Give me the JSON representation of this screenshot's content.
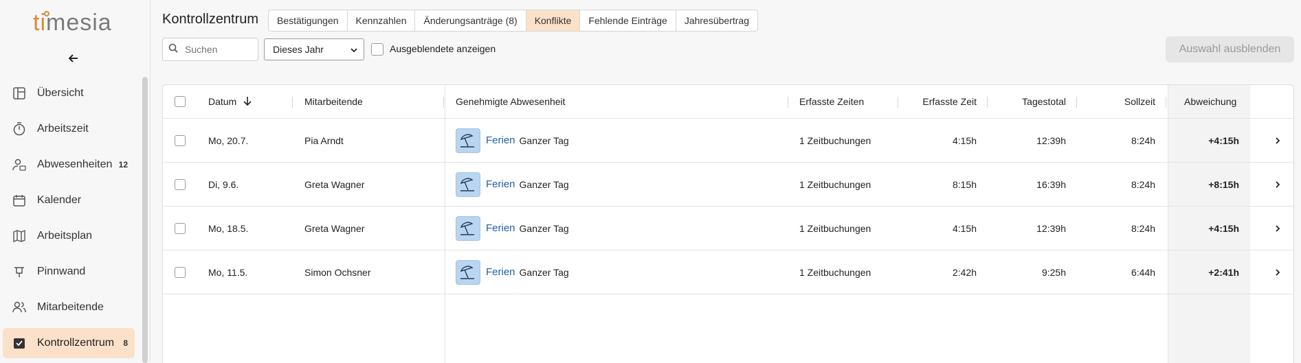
{
  "app": {
    "logo_ti": "ti",
    "logo_rest": "mesia"
  },
  "sidebar": {
    "collapse_icon": "arrow-left-icon",
    "items": [
      {
        "label": "Übersicht",
        "icon": "layout-icon",
        "badge": ""
      },
      {
        "label": "Arbeitszeit",
        "icon": "stopwatch-icon",
        "badge": ""
      },
      {
        "label": "Abwesenheiten",
        "icon": "person-absence-icon",
        "badge": "12"
      },
      {
        "label": "Kalender",
        "icon": "calendar-icon",
        "badge": ""
      },
      {
        "label": "Arbeitsplan",
        "icon": "map-icon",
        "badge": ""
      },
      {
        "label": "Pinnwand",
        "icon": "pin-board-icon",
        "badge": ""
      },
      {
        "label": "Mitarbeitende",
        "icon": "people-icon",
        "badge": ""
      },
      {
        "label": "Kontrollzentrum",
        "icon": "checkbox-icon",
        "badge": "8",
        "active": true
      }
    ]
  },
  "header": {
    "title": "Kontrollzentrum",
    "tabs": [
      "Bestätigungen",
      "Kennzahlen",
      "Änderungsanträge (8)",
      "Konflikte",
      "Fehlende Einträge",
      "Jahresübertrag"
    ],
    "active_tab": "Konflikte"
  },
  "filters": {
    "search_placeholder": "Suchen",
    "period": "Dieses Jahr",
    "show_hidden_label": "Ausgeblendete anzeigen",
    "hide_selection_label": "Auswahl ausblenden"
  },
  "table": {
    "columns": {
      "date": "Datum",
      "employee": "Mitarbeitende",
      "absence": "Genehmigte Abwesenheit",
      "entries": "Erfasste Zeiten",
      "recorded": "Erfasste Zeit",
      "daily_total": "Tagestotal",
      "target": "Sollzeit",
      "deviation": "Abweichung"
    },
    "rows": [
      {
        "date": "Mo, 20.7.",
        "employee": "Pia Arndt",
        "absence_type": "Ferien",
        "absence_duration": "Ganzer Tag",
        "entries": "1 Zeitbuchungen",
        "recorded": "4:15h",
        "daily_total": "12:39h",
        "target": "8:24h",
        "deviation": "+4:15h"
      },
      {
        "date": "Di, 9.6.",
        "employee": "Greta Wagner",
        "absence_type": "Ferien",
        "absence_duration": "Ganzer Tag",
        "entries": "1 Zeitbuchungen",
        "recorded": "8:15h",
        "daily_total": "16:39h",
        "target": "8:24h",
        "deviation": "+8:15h"
      },
      {
        "date": "Mo, 18.5.",
        "employee": "Greta Wagner",
        "absence_type": "Ferien",
        "absence_duration": "Ganzer Tag",
        "entries": "1 Zeitbuchungen",
        "recorded": "4:15h",
        "daily_total": "12:39h",
        "target": "8:24h",
        "deviation": "+4:15h"
      },
      {
        "date": "Mo, 11.5.",
        "employee": "Simon Ochsner",
        "absence_type": "Ferien",
        "absence_duration": "Ganzer Tag",
        "entries": "1 Zeitbuchungen",
        "recorded": "2:42h",
        "daily_total": "9:25h",
        "target": "6:44h",
        "deviation": "+2:41h"
      }
    ]
  }
}
